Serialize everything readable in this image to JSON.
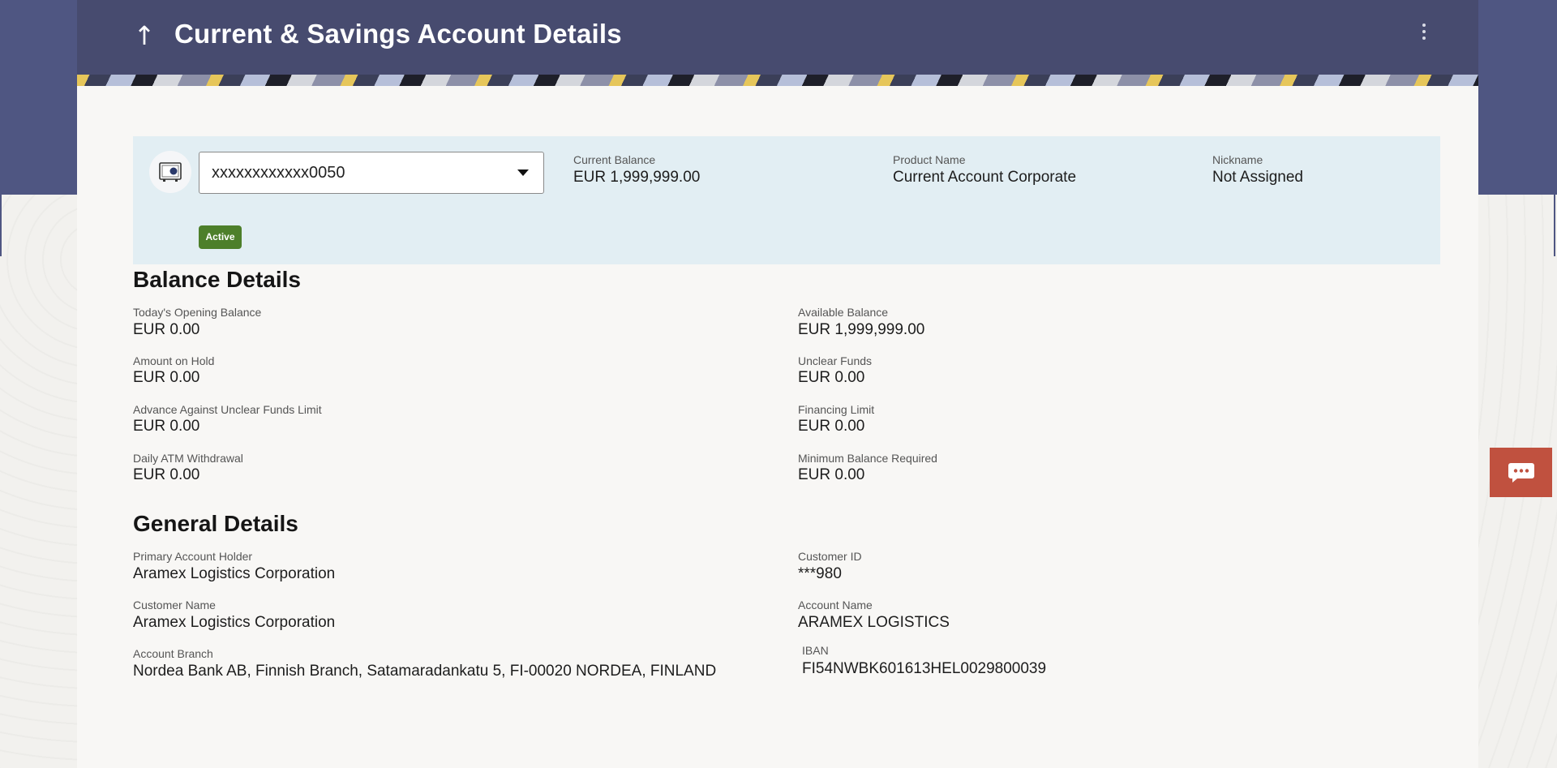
{
  "header": {
    "back_icon": "up-arrow-icon",
    "title": "Current & Savings Account Details",
    "menu_icon": "kebab-menu-icon"
  },
  "account": {
    "icon": "safe-icon",
    "selected": "xxxxxxxxxxxx0050",
    "status": "Active",
    "current_balance_label": "Current Balance",
    "current_balance_value": "EUR 1,999,999.00",
    "product_name_label": "Product Name",
    "product_name_value": "Current Account Corporate",
    "nickname_label": "Nickname",
    "nickname_value": "Not Assigned"
  },
  "balance_details": {
    "title": "Balance Details",
    "items": [
      {
        "label": "Today's Opening Balance",
        "value": "EUR 0.00"
      },
      {
        "label": "Available Balance",
        "value": "EUR 1,999,999.00"
      },
      {
        "label": "Amount on Hold",
        "value": "EUR 0.00"
      },
      {
        "label": "Unclear Funds",
        "value": "EUR 0.00"
      },
      {
        "label": "Advance Against Unclear Funds Limit",
        "value": "EUR 0.00"
      },
      {
        "label": "Financing Limit",
        "value": "EUR 0.00"
      },
      {
        "label": "Daily ATM Withdrawal",
        "value": "EUR 0.00"
      },
      {
        "label": "Minimum Balance Required",
        "value": "EUR 0.00"
      }
    ]
  },
  "general_details": {
    "title": "General Details",
    "items": [
      {
        "label": "Primary Account Holder",
        "value": "Aramex Logistics Corporation"
      },
      {
        "label": "Customer ID",
        "value": "***980"
      },
      {
        "label": "Customer Name",
        "value": "Aramex Logistics Corporation"
      },
      {
        "label": "Account Name",
        "value": "ARAMEX LOGISTICS"
      },
      {
        "label": "Account Branch",
        "value": "Nordea Bank AB, Finnish Branch, Satamaradankatu 5, FI-00020 NORDEA, FINLAND"
      },
      {
        "label": "IBAN",
        "value": "FI54NWBK601613HEL0029800039"
      }
    ]
  },
  "chat": {
    "icon": "chat-bubble-icon"
  },
  "colors": {
    "header_bg": "#474b6f",
    "banner_bg": "#e2eef3",
    "status_active": "#4d7f2a",
    "chat_button": "#c0513f"
  }
}
